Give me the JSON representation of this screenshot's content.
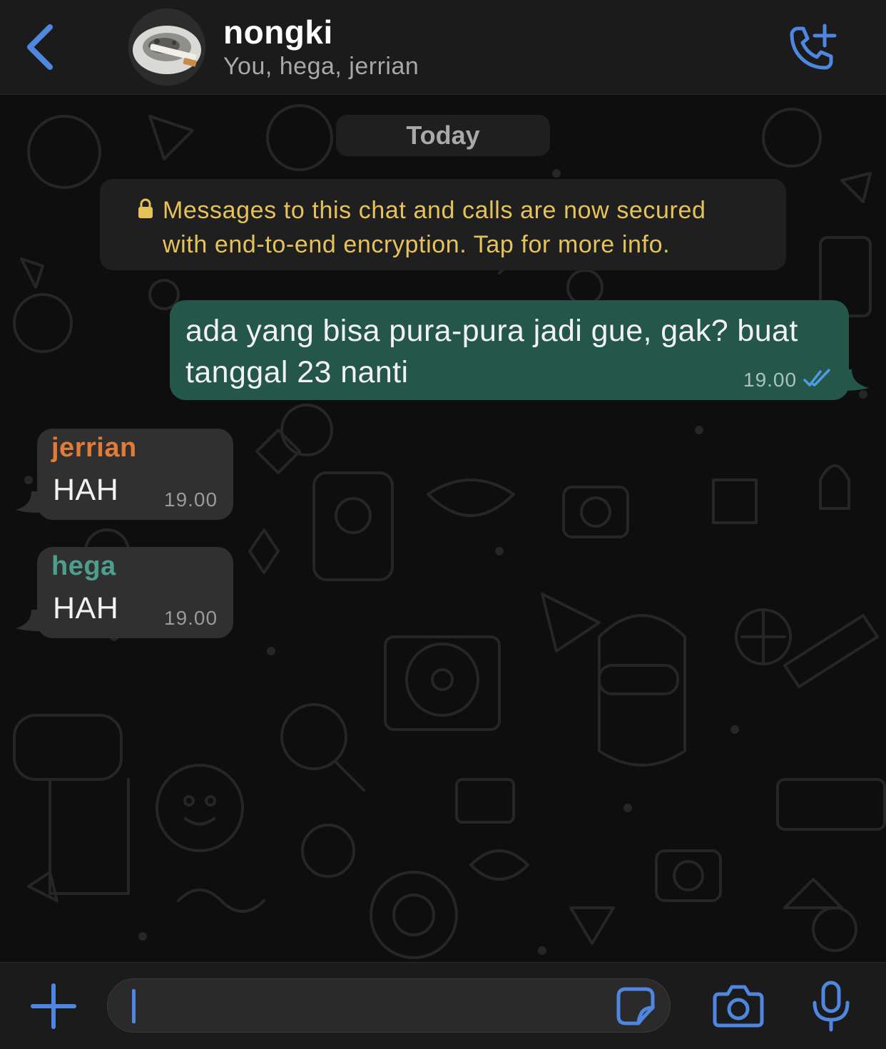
{
  "header": {
    "title": "nongki",
    "subtitle": "You, hega, jerrian"
  },
  "chat": {
    "date_label": "Today",
    "encryption_notice": {
      "line1": "Messages to this chat and calls are now secured",
      "line2": "with end-to-end encryption. Tap for more info."
    },
    "messages": [
      {
        "direction": "outgoing",
        "text": "ada yang bisa pura-pura jadi gue, gak? buat tanggal 23 nanti",
        "time": "19.00",
        "status": "read"
      },
      {
        "direction": "incoming",
        "sender": "jerrian",
        "sender_color": "#e07b39",
        "text": "HAH",
        "time": "19.00"
      },
      {
        "direction": "incoming",
        "sender": "hega",
        "sender_color": "#4e9e8e",
        "text": "HAH",
        "time": "19.00"
      }
    ]
  },
  "composer": {
    "value": ""
  },
  "icons": {
    "back": "chevron-left-icon",
    "call": "add-call-icon",
    "plus": "plus-icon",
    "sticker": "sticker-icon",
    "camera": "camera-icon",
    "mic": "microphone-icon",
    "lock": "lock-icon"
  },
  "colors": {
    "accent": "#4f86df",
    "outgoing_bubble": "#24564a",
    "incoming_bubble": "#303030",
    "notice_text": "#e6c25a",
    "read_ticks": "#4f9be0"
  }
}
